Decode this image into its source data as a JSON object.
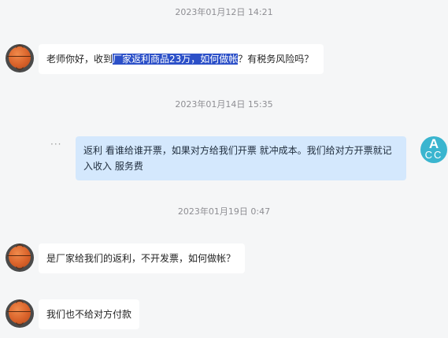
{
  "messages": [
    {
      "timestamp": "2023年01月12日 14:21",
      "text_before": "老师你好，收到",
      "text_highlight": "厂家返利商品23万，如何做帐",
      "text_after": "？有税务风险吗？"
    },
    {
      "timestamp": "2023年01月14日 15:35",
      "text": "返利 看谁给谁开票，如果对方给我们开票 就冲成本。我们给对方开票就记入收入 服务费",
      "sender_avatar_line1": "A",
      "sender_avatar_line2": "CC",
      "more_icon": "···"
    },
    {
      "timestamp": "2023年01月19日 0:47",
      "text": "是厂家给我们的返利，不开发票，如何做帐？"
    },
    {
      "text": "我们也不给对方付款"
    }
  ],
  "colors": {
    "background": "#f5f6f7",
    "incoming_bubble": "#ffffff",
    "outgoing_bubble": "#d4e8fd",
    "selection_highlight": "#2c50c8",
    "acc_avatar": "#3ab5cf"
  }
}
